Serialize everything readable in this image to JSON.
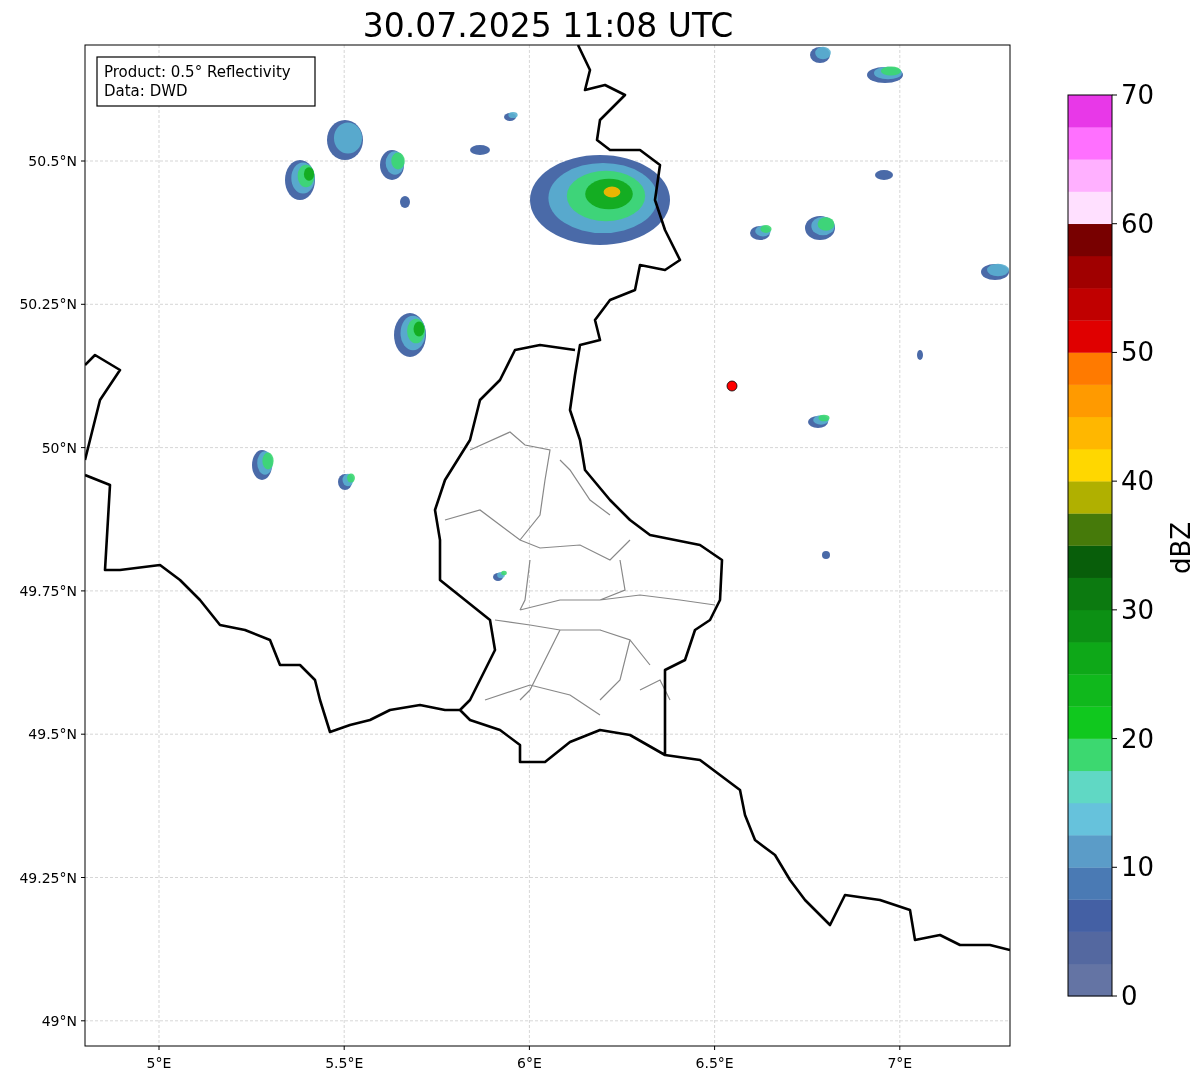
{
  "title": "30.07.2025 11:08 UTC",
  "info_box": {
    "lines": [
      "Product: 0.5° Reflectivity",
      "Data: DWD"
    ]
  },
  "map": {
    "lat_ticks": [
      "50.5°N",
      "50.25°N",
      "50°N",
      "49.75°N",
      "49.5°N",
      "49.25°N",
      "49°N"
    ],
    "lon_ticks": [
      "5°E",
      "5.5°E",
      "6°E",
      "6.5°E",
      "7°E"
    ]
  },
  "colorbar": {
    "label": "dBZ",
    "ticks": [
      "70",
      "60",
      "50",
      "40",
      "30",
      "20",
      "10",
      "0"
    ],
    "bands": [
      {
        "color": "#6474a4"
      },
      {
        "color": "#5468a0"
      },
      {
        "color": "#4460a4"
      },
      {
        "color": "#4a7ab4"
      },
      {
        "color": "#5b9cc8"
      },
      {
        "color": "#66c2dc"
      },
      {
        "color": "#60d8c4"
      },
      {
        "color": "#3cd870"
      },
      {
        "color": "#10c81e"
      },
      {
        "color": "#10b81c"
      },
      {
        "color": "#0ea818"
      },
      {
        "color": "#0c9014"
      },
      {
        "color": "#0c7a10"
      },
      {
        "color": "#085e0a"
      },
      {
        "color": "#467a0a"
      },
      {
        "color": "#b0b000"
      },
      {
        "color": "#ffd700"
      },
      {
        "color": "#ffb700"
      },
      {
        "color": "#ff9a00"
      },
      {
        "color": "#ff7a00"
      },
      {
        "color": "#e00000"
      },
      {
        "color": "#c00000"
      },
      {
        "color": "#a00000"
      },
      {
        "color": "#780000"
      },
      {
        "color": "#ffe0ff"
      },
      {
        "color": "#ffb0ff"
      },
      {
        "color": "#ff70ff"
      },
      {
        "color": "#e838e8"
      }
    ]
  }
}
